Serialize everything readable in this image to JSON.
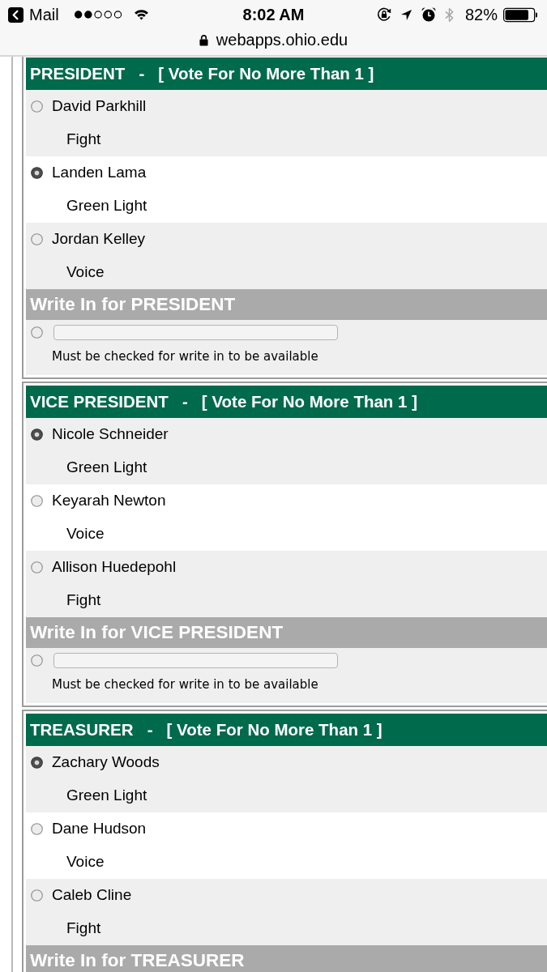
{
  "status_bar": {
    "back_label": "Mail",
    "time": "8:02 AM",
    "bluetooth_on": false,
    "battery": "82%"
  },
  "address_bar": {
    "secure": true,
    "url": "webapps.ohio.edu"
  },
  "ballot": [
    {
      "header": "PRESIDENT   -   [ Vote For No More Than 1 ]",
      "candidates": [
        {
          "name": "David Parkhill",
          "party": "Fight",
          "selected": false
        },
        {
          "name": "Landen Lama",
          "party": "Green Light",
          "selected": true
        },
        {
          "name": "Jordan Kelley",
          "party": "Voice",
          "selected": false
        }
      ],
      "write_in": {
        "header": "Write In for PRESIDENT",
        "selected": false,
        "note": "Must be checked for write in to be available"
      }
    },
    {
      "header": "VICE PRESIDENT   -   [ Vote For No More Than 1 ]",
      "candidates": [
        {
          "name": "Nicole Schneider",
          "party": "Green Light",
          "selected": true
        },
        {
          "name": "Keyarah Newton",
          "party": "Voice",
          "selected": false
        },
        {
          "name": "Allison Huedepohl",
          "party": "Fight",
          "selected": false
        }
      ],
      "write_in": {
        "header": "Write In for VICE PRESIDENT",
        "selected": false,
        "note": "Must be checked for write in to be available"
      }
    },
    {
      "header": "TREASURER   -   [ Vote For No More Than 1 ]",
      "candidates": [
        {
          "name": "Zachary Woods",
          "party": "Green Light",
          "selected": true
        },
        {
          "name": "Dane Hudson",
          "party": "Voice",
          "selected": false
        },
        {
          "name": "Caleb Cline",
          "party": "Fight",
          "selected": false
        }
      ],
      "write_in": {
        "header": "Write In for TREASURER"
      }
    }
  ]
}
